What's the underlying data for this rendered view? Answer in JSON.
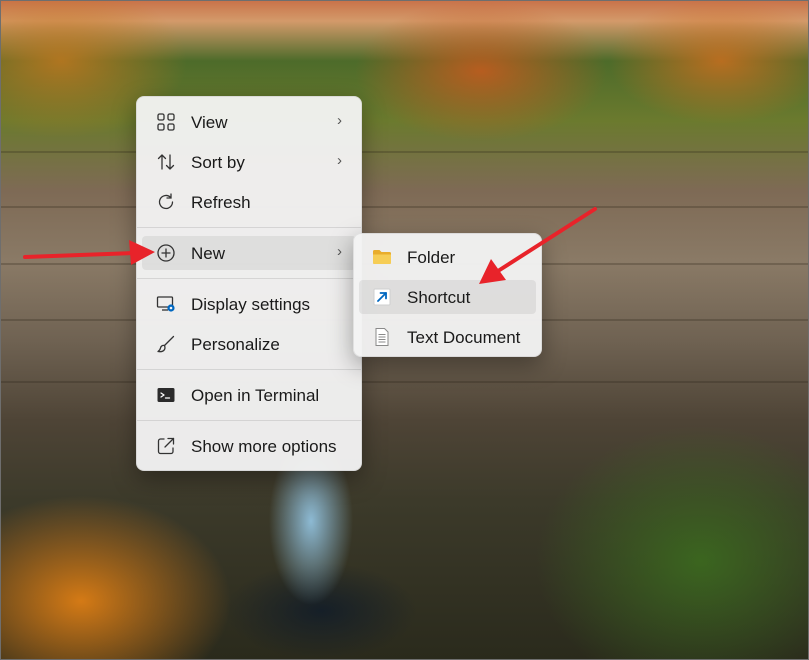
{
  "context_menu": {
    "items": [
      {
        "label": "View",
        "icon": "grid-icon",
        "has_submenu": true
      },
      {
        "label": "Sort by",
        "icon": "sort-arrows-icon",
        "has_submenu": true
      },
      {
        "label": "Refresh",
        "icon": "refresh-icon",
        "has_submenu": false
      },
      {
        "label": "New",
        "icon": "add-circle-icon",
        "has_submenu": true
      },
      {
        "label": "Display settings",
        "icon": "display-settings-icon",
        "has_submenu": false
      },
      {
        "label": "Personalize",
        "icon": "brush-icon",
        "has_submenu": false
      },
      {
        "label": "Open in Terminal",
        "icon": "terminal-icon",
        "has_submenu": false
      },
      {
        "label": "Show more options",
        "icon": "share-arrow-icon",
        "has_submenu": false
      }
    ],
    "chevron": "›"
  },
  "new_submenu": {
    "items": [
      {
        "label": "Folder",
        "icon": "folder-icon"
      },
      {
        "label": "Shortcut",
        "icon": "shortcut-arrow-icon"
      },
      {
        "label": "Text Document",
        "icon": "text-document-icon"
      }
    ]
  },
  "colors": {
    "menu_background": "#f3f3f3",
    "annotation_arrow": "#e8232a",
    "folder": "#f2c242",
    "accent": "#0067c0"
  }
}
